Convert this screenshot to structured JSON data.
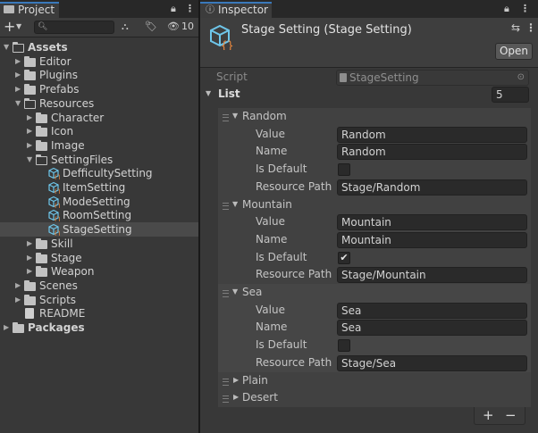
{
  "project": {
    "tab_label": "Project",
    "add_label": "+",
    "search_placeholder": "",
    "hidden_count": "10",
    "tree": [
      {
        "label": "Assets",
        "depth": 0,
        "expanded": true,
        "bold": true,
        "kind": "folder"
      },
      {
        "label": "Editor",
        "depth": 1,
        "expanded": false,
        "kind": "folder"
      },
      {
        "label": "Plugins",
        "depth": 1,
        "expanded": false,
        "kind": "folder"
      },
      {
        "label": "Prefabs",
        "depth": 1,
        "expanded": false,
        "kind": "folder"
      },
      {
        "label": "Resources",
        "depth": 1,
        "expanded": true,
        "kind": "folder"
      },
      {
        "label": "Character",
        "depth": 2,
        "expanded": false,
        "kind": "folder"
      },
      {
        "label": "Icon",
        "depth": 2,
        "expanded": false,
        "kind": "folder"
      },
      {
        "label": "Image",
        "depth": 2,
        "expanded": false,
        "kind": "folder"
      },
      {
        "label": "SettingFiles",
        "depth": 2,
        "expanded": true,
        "kind": "folder"
      },
      {
        "label": "DefficultySetting",
        "depth": 3,
        "kind": "asset"
      },
      {
        "label": "ItemSetting",
        "depth": 3,
        "kind": "asset"
      },
      {
        "label": "ModeSetting",
        "depth": 3,
        "kind": "asset"
      },
      {
        "label": "RoomSetting",
        "depth": 3,
        "kind": "asset"
      },
      {
        "label": "StageSetting",
        "depth": 3,
        "kind": "asset",
        "selected": true
      },
      {
        "label": "Skill",
        "depth": 2,
        "expanded": false,
        "kind": "folder"
      },
      {
        "label": "Stage",
        "depth": 2,
        "expanded": false,
        "kind": "folder"
      },
      {
        "label": "Weapon",
        "depth": 2,
        "expanded": false,
        "kind": "folder"
      },
      {
        "label": "Scenes",
        "depth": 1,
        "expanded": false,
        "kind": "folder"
      },
      {
        "label": "Scripts",
        "depth": 1,
        "expanded": false,
        "kind": "folder"
      },
      {
        "label": "README",
        "depth": 1,
        "kind": "doc"
      },
      {
        "label": "Packages",
        "depth": 0,
        "expanded": false,
        "bold": true,
        "kind": "folder"
      }
    ]
  },
  "inspector": {
    "tab_label": "Inspector",
    "title": "Stage Setting (Stage Setting)",
    "open_label": "Open",
    "script_label": "Script",
    "script_value": "StageSetting",
    "list_label": "List",
    "list_size": "5",
    "labels": {
      "value": "Value",
      "name": "Name",
      "is_default": "Is Default",
      "resource_path": "Resource Path"
    },
    "elements": [
      {
        "header": "Random",
        "value": "Random",
        "name": "Random",
        "is_default": false,
        "resource_path": "Stage/Random"
      },
      {
        "header": "Mountain",
        "value": "Mountain",
        "name": "Mountain",
        "is_default": true,
        "resource_path": "Stage/Mountain"
      },
      {
        "header": "Sea",
        "value": "Sea",
        "name": "Sea",
        "is_default": false,
        "resource_path": "Stage/Sea"
      }
    ],
    "collapsed_elements": [
      "Plain",
      "Desert"
    ],
    "checkmark": "✔",
    "plus_label": "+",
    "minus_label": "−"
  },
  "colors": {
    "accent_tab": "#3a79bb",
    "selected_row": "#4a4a4a",
    "asset_icon": "#6ec6ea",
    "asset_icon_bracket": "#f08a3c"
  }
}
